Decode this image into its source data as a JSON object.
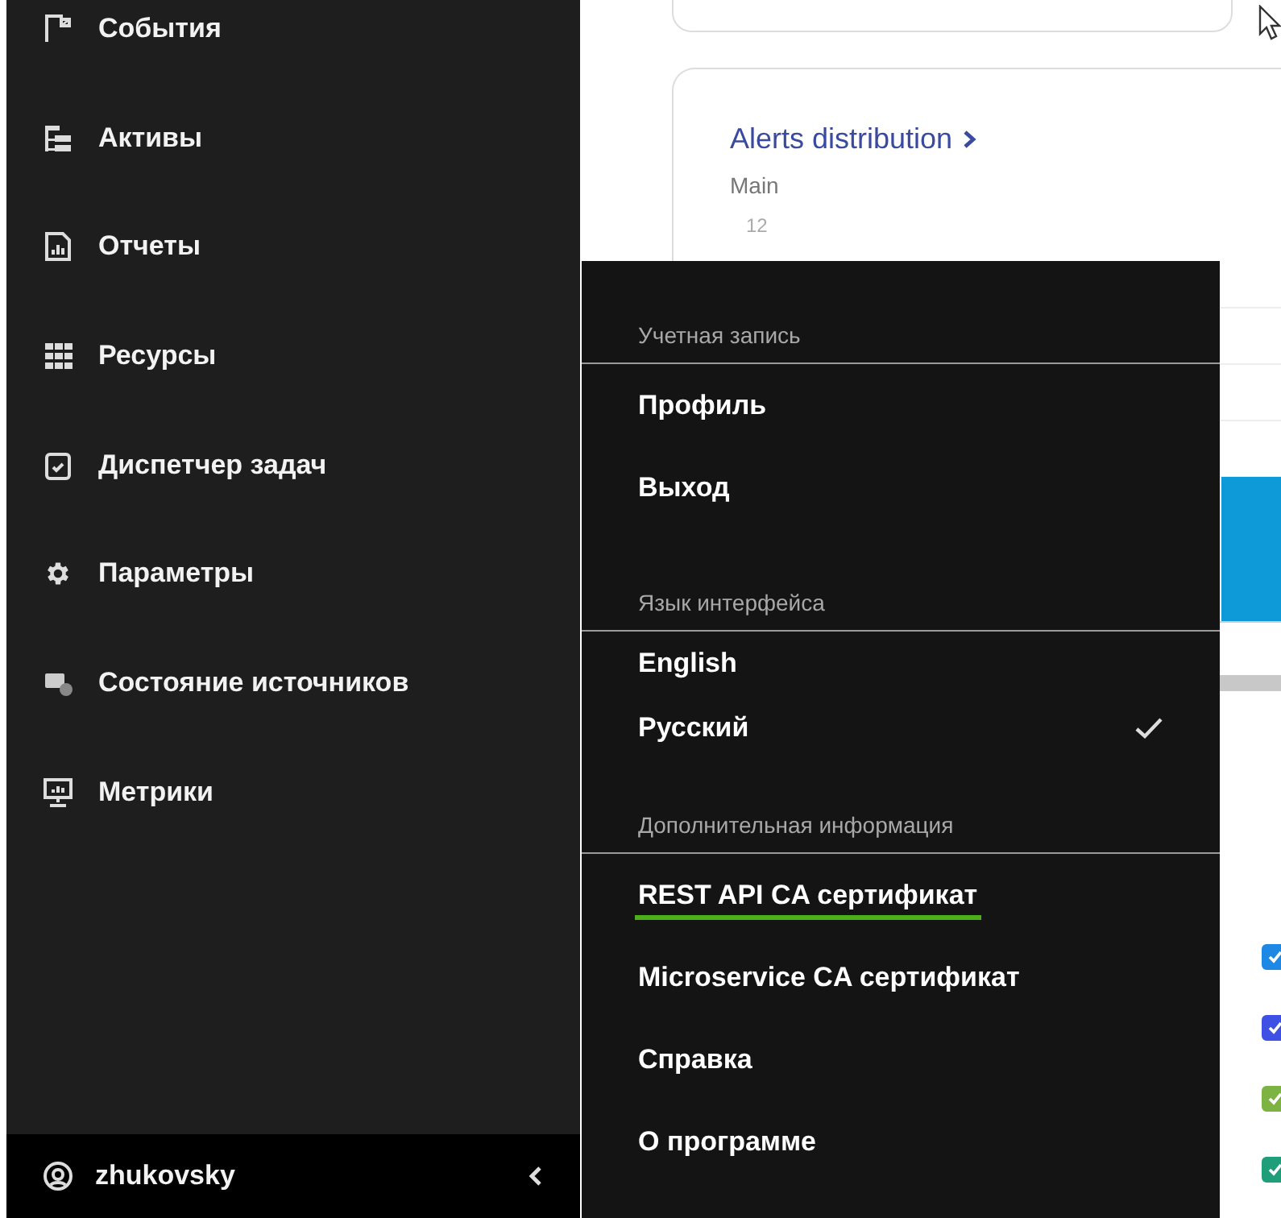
{
  "sidebar": {
    "items": [
      {
        "label": "События"
      },
      {
        "label": "Активы"
      },
      {
        "label": "Отчеты"
      },
      {
        "label": "Ресурсы"
      },
      {
        "label": "Диспетчер задач"
      },
      {
        "label": "Параметры"
      },
      {
        "label": "Состояние источников"
      },
      {
        "label": "Метрики"
      }
    ],
    "user": {
      "name": "zhukovsky"
    }
  },
  "dashboard": {
    "widget": {
      "title": "Alerts distribution",
      "subtitle": "Main",
      "y_tick": "12",
      "legend": [
        {
          "color": "#1e88e5",
          "checked": true
        },
        {
          "color": "#3f51e5",
          "checked": true
        },
        {
          "color": "#7cb342",
          "checked": true
        },
        {
          "color": "#1f9e7a",
          "checked": true
        }
      ]
    }
  },
  "user_menu": {
    "sections": [
      {
        "header": "Учетная запись",
        "items": [
          {
            "kind": "action",
            "label": "Профиль",
            "focused": false
          },
          {
            "kind": "action",
            "label": "Выход",
            "focused": false
          }
        ]
      },
      {
        "header": "Язык интерфейса",
        "items": [
          {
            "kind": "option",
            "label": "English",
            "selected": false
          },
          {
            "kind": "option",
            "label": "Русский",
            "selected": true
          }
        ]
      },
      {
        "header": "Дополнительная информация",
        "items": [
          {
            "kind": "action",
            "label": "REST API CA сертификат",
            "focused": true
          },
          {
            "kind": "action",
            "label": "Microservice CA сертификат",
            "focused": false
          },
          {
            "kind": "action",
            "label": "Справка",
            "focused": false
          },
          {
            "kind": "action",
            "label": "О программе",
            "focused": false
          }
        ]
      }
    ]
  }
}
